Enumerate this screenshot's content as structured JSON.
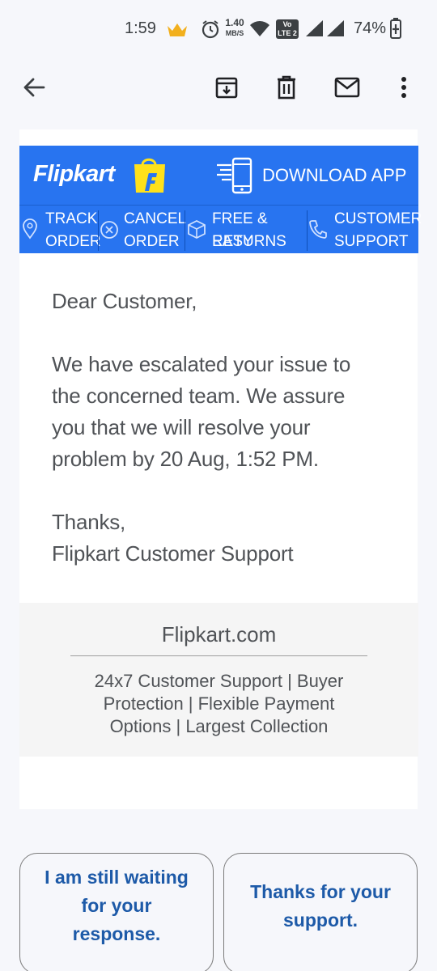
{
  "status_bar": {
    "time": "1:59",
    "network_speed": "1.40",
    "network_speed_unit": "MB/S",
    "volte": "Vo",
    "lte": "LTE 2",
    "battery": "74%"
  },
  "app_bar": {
    "icons": [
      "back-arrow-icon",
      "archive-icon",
      "delete-icon",
      "mark-unread-icon",
      "more-vert-icon"
    ]
  },
  "email": {
    "brand": "Flipkart",
    "download_app": "DOWNLOAD APP",
    "nav": [
      {
        "line1": "TRACK",
        "line2": "ORDER"
      },
      {
        "line1": "CANCEL",
        "line2": "ORDER"
      },
      {
        "line1": "FREE & EASY",
        "line2": "RETURNS"
      },
      {
        "line1": "CUSTOMER",
        "line2": "SUPPORT"
      }
    ],
    "greeting": "Dear Customer,",
    "message_lines": [
      "We have escalated your issue to",
      "the concerned team. We assure",
      "you that we will resolve your",
      "problem by 20 Aug, 1:52 PM."
    ],
    "signoff": "Thanks,",
    "signature": "Flipkart Customer Support",
    "footer_domain": "Flipkart.com",
    "footer_tagline": "24x7 Customer Support | Buyer Protection | Flexible Payment Options | Largest Collection"
  },
  "smart_replies": [
    "I am still waiting for your response.",
    "Thanks for your support."
  ],
  "colors": {
    "flipkart_blue": "#2874f0",
    "flipkart_yellow": "#ffe11b",
    "reply_text": "#1d5aa8"
  }
}
